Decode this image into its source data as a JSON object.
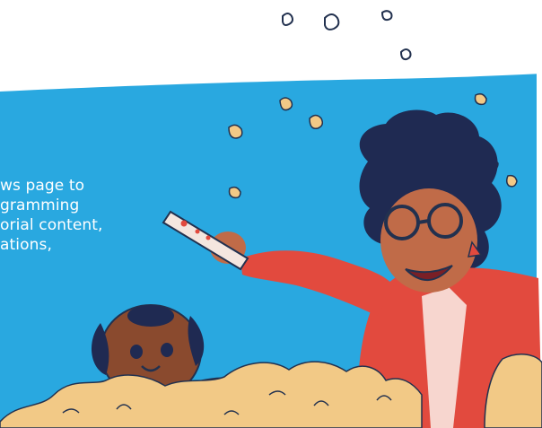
{
  "blurb": {
    "lines": [
      "ws page to",
      "gramming",
      "orial content,",
      "ations,"
    ]
  },
  "colors": {
    "sky": "#29a8e0",
    "popcorn": "#f2c986",
    "jacket": "#e24a3e",
    "hair": "#1f2a52",
    "skin": "#c06b48",
    "dog": "#8a4a2e"
  },
  "illustration": {
    "subjects": [
      "woman-with-remote",
      "dog",
      "popcorn"
    ]
  }
}
